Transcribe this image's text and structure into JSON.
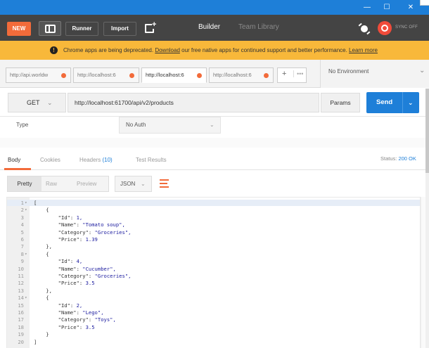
{
  "window": {
    "min_glyph": "—",
    "max_glyph": "☐",
    "close_glyph": "✕"
  },
  "toolbar": {
    "new_label": "NEW",
    "runner_label": "Runner",
    "import_label": "Import",
    "builder_label": "Builder",
    "team_label": "Team Library",
    "sync_label": "SYNC OFF"
  },
  "banner": {
    "icon": "!",
    "text_before": "Chrome apps are being deprecated. ",
    "download_link": "Download",
    "text_middle": " our free native apps for continued support and better performance. ",
    "learn_link": "Learn more"
  },
  "tabs": [
    {
      "label": "http://api.worldw"
    },
    {
      "label": "http://localhost:6"
    },
    {
      "label": "http://localhost:6"
    },
    {
      "label": "http://localhost:6"
    }
  ],
  "add_tab": {
    "plus": "+",
    "more": "•••"
  },
  "environment": {
    "label": "No Environment",
    "chevron": "⌄"
  },
  "request": {
    "method": "GET",
    "url": "http://localhost:61700/api/v2/products",
    "params_label": "Params",
    "send_label": "Send"
  },
  "auth": {
    "type_label": "Type",
    "value": "No Auth"
  },
  "response_tabs": {
    "body": "Body",
    "cookies": "Cookies",
    "headers": "Headers",
    "headers_count": "(10)",
    "tests": "Test Results",
    "status_label": "Status:",
    "status_value": "200 OK"
  },
  "view": {
    "pretty": "Pretty",
    "raw": "Raw",
    "preview": "Preview",
    "format": "JSON"
  },
  "code_lines": [
    {
      "num": "1",
      "fold": "▾",
      "text": "["
    },
    {
      "num": "2",
      "fold": "▾",
      "text": "    {"
    },
    {
      "num": "3",
      "fold": "",
      "text": "        \"Id\": 1,"
    },
    {
      "num": "4",
      "fold": "",
      "text": "        \"Name\": \"Tomato soup\","
    },
    {
      "num": "5",
      "fold": "",
      "text": "        \"Category\": \"Groceries\","
    },
    {
      "num": "6",
      "fold": "",
      "text": "        \"Price\": 1.39"
    },
    {
      "num": "7",
      "fold": "",
      "text": "    },"
    },
    {
      "num": "8",
      "fold": "▾",
      "text": "    {"
    },
    {
      "num": "9",
      "fold": "",
      "text": "        \"Id\": 4,"
    },
    {
      "num": "10",
      "fold": "",
      "text": "        \"Name\": \"Cucumber\","
    },
    {
      "num": "11",
      "fold": "",
      "text": "        \"Category\": \"Groceries\","
    },
    {
      "num": "12",
      "fold": "",
      "text": "        \"Price\": 3.5"
    },
    {
      "num": "13",
      "fold": "",
      "text": "    },"
    },
    {
      "num": "14",
      "fold": "▾",
      "text": "    {"
    },
    {
      "num": "15",
      "fold": "",
      "text": "        \"Id\": 2,"
    },
    {
      "num": "16",
      "fold": "",
      "text": "        \"Name\": \"Lego\","
    },
    {
      "num": "17",
      "fold": "",
      "text": "        \"Category\": \"Toys\","
    },
    {
      "num": "18",
      "fold": "",
      "text": "        \"Price\": 3.5"
    },
    {
      "num": "19",
      "fold": "",
      "text": "    }"
    },
    {
      "num": "20",
      "fold": "",
      "text": "]"
    }
  ],
  "colors": {
    "accent_orange": "#f26b3a",
    "accent_blue": "#1e7fd8",
    "banner_yellow": "#f8b83a",
    "toolbar_dark": "#444444"
  }
}
